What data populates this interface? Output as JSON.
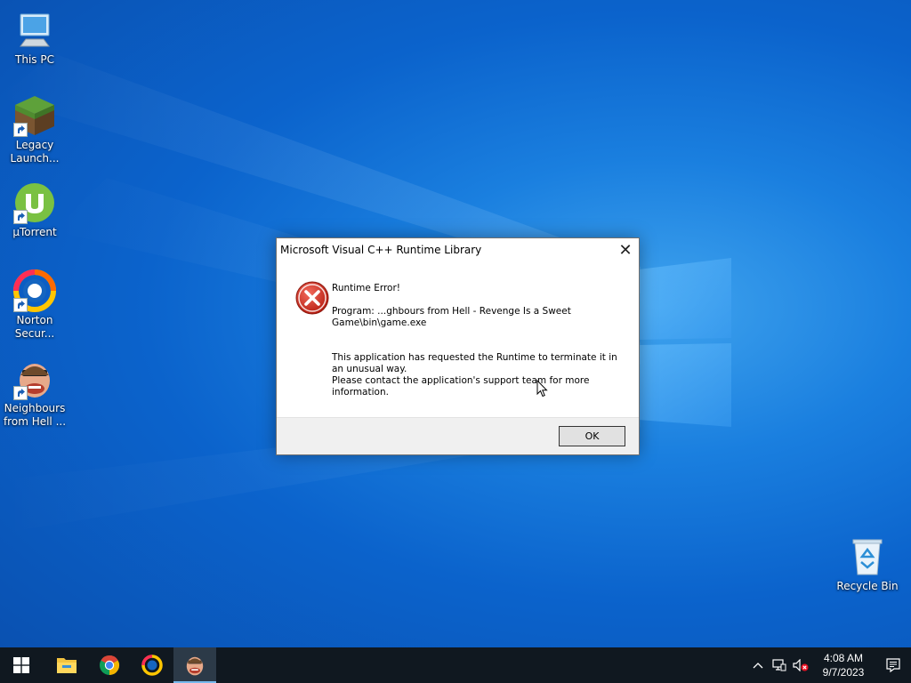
{
  "desktop": {
    "icons": [
      {
        "label": "This PC",
        "icon": "this-pc-icon"
      },
      {
        "label": "Legacy\nLaunch...",
        "icon": "minecraft-grass-block-icon"
      },
      {
        "label": "µTorrent",
        "icon": "utorrent-icon"
      },
      {
        "label": "Norton\nSecur...",
        "icon": "norton-icon"
      },
      {
        "label": "Neighbours\nfrom Hell ...",
        "icon": "neighbours-from-hell-icon"
      },
      {
        "label": "Recycle Bin",
        "icon": "recycle-bin-icon"
      }
    ]
  },
  "dialog": {
    "title": "Microsoft Visual C++ Runtime Library",
    "close_glyph": "✕",
    "heading": "Runtime Error!",
    "program": "Program: ...ghbours from Hell - Revenge Is a Sweet\nGame\\bin\\game.exe",
    "message1": "This application has requested the Runtime to terminate it in\nan unusual way.",
    "message2": "Please contact the application's support team for more\ninformation.",
    "ok_label": "OK",
    "icon": "error-icon"
  },
  "taskbar": {
    "apps": [
      "start-icon",
      "file-explorer-icon",
      "chrome-icon",
      "norton-icon",
      "neighbours-from-hell-icon"
    ],
    "active_app": "neighbours-from-hell-icon",
    "tray": {
      "time": "4:08 AM",
      "date": "9/7/2023",
      "icons": [
        "chevron-up-icon",
        "network-icon",
        "volume-muted-icon"
      ]
    }
  },
  "colors": {
    "desktop_accent": "#0b63cc",
    "error_red": "#c42b1c",
    "taskbar": "#101820",
    "active_underline": "#76b9ed"
  }
}
